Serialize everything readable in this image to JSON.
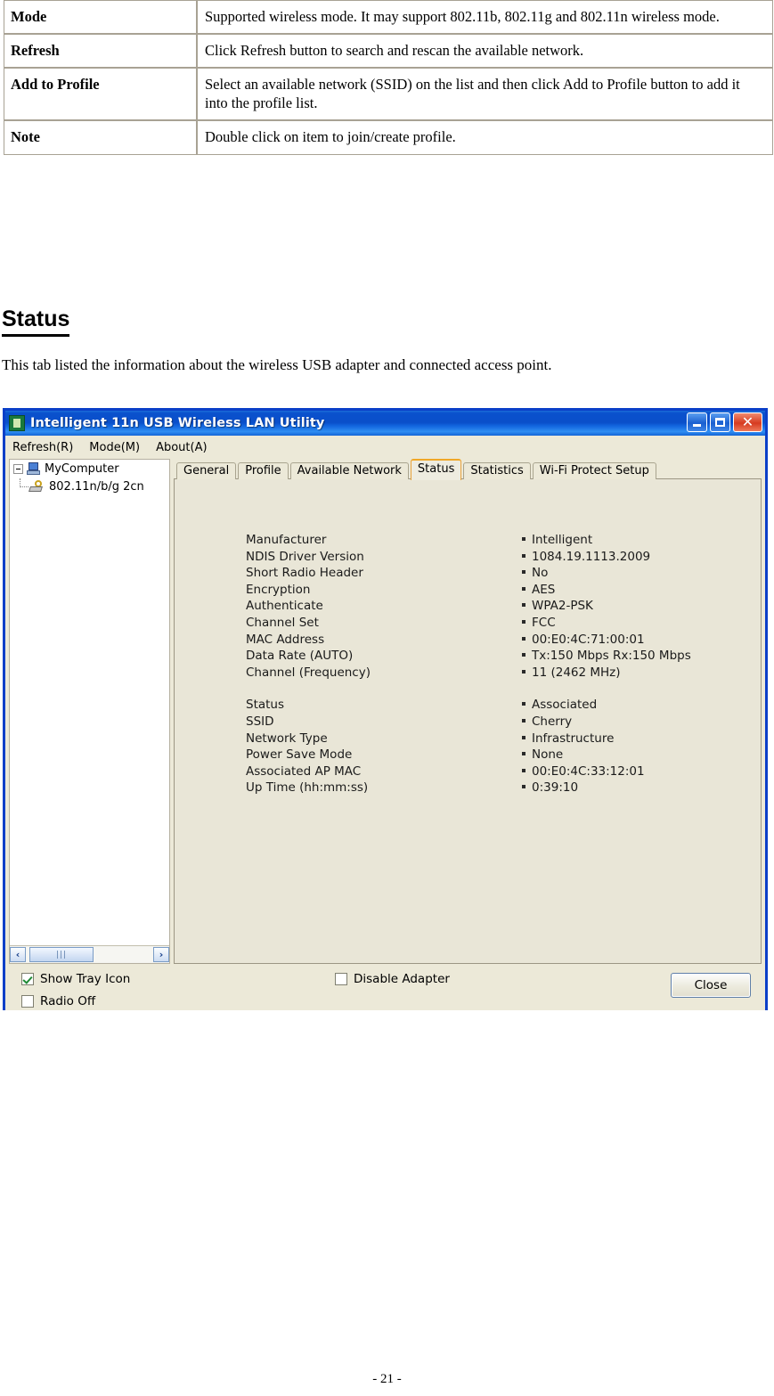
{
  "document": {
    "table": {
      "rows": [
        {
          "key": "Mode",
          "value": "Supported wireless mode. It may support 802.11b, 802.11g and 802.11n wireless mode."
        },
        {
          "key": "Refresh",
          "value": "Click Refresh button to search and rescan the available network."
        },
        {
          "key": "Add to Profile",
          "value": "Select an available network (SSID) on the list and then click Add to Profile button to add it into the profile list."
        },
        {
          "key": "Note",
          "value": "Double click on item to join/create profile."
        }
      ]
    },
    "section_title": "Status",
    "section_text": "This tab listed the information about the wireless USB adapter and connected access point.",
    "page_number": "- 21 -"
  },
  "app": {
    "title": "Intelligent 11n USB Wireless LAN Utility",
    "title_icon": "app-icon",
    "window_buttons": {
      "minimize": "minimize-button",
      "maximize": "maximize-button",
      "close": "close-button"
    },
    "menu": [
      {
        "label": "Refresh(R)"
      },
      {
        "label": "Mode(M)"
      },
      {
        "label": "About(A)"
      }
    ],
    "tree": {
      "root": "MyComputer",
      "child": "802.11n/b/g 2cn",
      "scroll_left": "‹",
      "scroll_right": "›"
    },
    "tabs": [
      {
        "label": "General",
        "active": false
      },
      {
        "label": "Profile",
        "active": false
      },
      {
        "label": "Available Network",
        "active": false
      },
      {
        "label": "Status",
        "active": true
      },
      {
        "label": "Statistics",
        "active": false
      },
      {
        "label": "Wi-Fi Protect Setup",
        "active": false
      }
    ],
    "status_rows": [
      {
        "label": "Manufacturer",
        "value": "Intelligent"
      },
      {
        "label": "NDIS Driver Version",
        "value": "1084.19.1113.2009"
      },
      {
        "label": "Short Radio Header",
        "value": "No"
      },
      {
        "label": "Encryption",
        "value": "AES"
      },
      {
        "label": "Authenticate",
        "value": "WPA2-PSK"
      },
      {
        "label": "Channel Set",
        "value": "FCC"
      },
      {
        "label": "MAC Address",
        "value": "00:E0:4C:71:00:01"
      },
      {
        "label": "Data Rate (AUTO)",
        "value": "Tx:150 Mbps Rx:150 Mbps"
      },
      {
        "label": "Channel (Frequency)",
        "value": "11 (2462 MHz)"
      }
    ],
    "status_rows2": [
      {
        "label": "Status",
        "value": "Associated"
      },
      {
        "label": "SSID",
        "value": "Cherry"
      },
      {
        "label": "Network Type",
        "value": "Infrastructure"
      },
      {
        "label": "Power Save Mode",
        "value": "None"
      },
      {
        "label": "Associated AP MAC",
        "value": "00:E0:4C:33:12:01"
      },
      {
        "label": "Up Time (hh:mm:ss)",
        "value": "0:39:10"
      }
    ],
    "bottom": {
      "show_tray_icon": {
        "label": "Show Tray Icon",
        "checked": true
      },
      "radio_off": {
        "label": "Radio Off",
        "checked": false
      },
      "disable_adapter": {
        "label": "Disable Adapter",
        "checked": false
      },
      "close_button": "Close"
    }
  },
  "colors": {
    "title_bar_blue": "#0a4fca",
    "window_border": "#0b3fc8",
    "panel_bg": "#e9e6d7",
    "chrome_bg": "#ece9d8",
    "active_tab_accent": "#f0a828",
    "table_border": "#a8a294"
  }
}
